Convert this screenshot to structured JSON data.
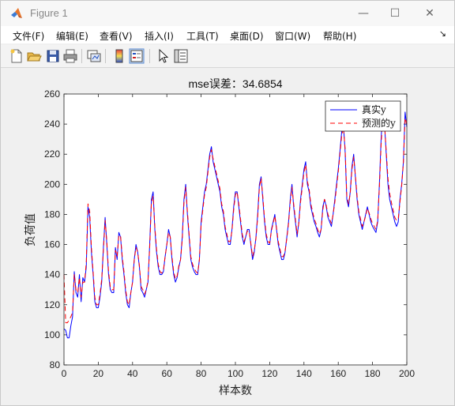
{
  "window": {
    "title": "Figure 1"
  },
  "window_controls": {
    "minimize": "—",
    "maximize": "☐",
    "close": "✕"
  },
  "menu": {
    "items": [
      "文件(F)",
      "编辑(E)",
      "查看(V)",
      "插入(I)",
      "工具(T)",
      "桌面(D)",
      "窗口(W)",
      "帮助(H)"
    ],
    "overflow": "↘"
  },
  "toolbar": {
    "icons": [
      "new-figure-icon",
      "open-file-icon",
      "save-icon",
      "print-icon",
      "link-plot-icon",
      "colorbar-icon",
      "legend-icon",
      "pointer-icon",
      "property-inspector-icon"
    ]
  },
  "chart_data": {
    "type": "line",
    "title": "mse误差：34.6854",
    "xlabel": "样本数",
    "ylabel": "负荷值",
    "xlim": [
      0,
      200
    ],
    "ylim": [
      80,
      260
    ],
    "xticks": [
      0,
      20,
      40,
      60,
      80,
      100,
      120,
      140,
      160,
      180,
      200
    ],
    "yticks": [
      80,
      100,
      120,
      140,
      160,
      180,
      200,
      220,
      240,
      260
    ],
    "legend_position": "top-right",
    "series": [
      {
        "name": "真实y",
        "color": "#0000ff",
        "style": "solid",
        "values": [
          104,
          103,
          98,
          98,
          106,
          112,
          142,
          128,
          125,
          140,
          122,
          138,
          135,
          145,
          185,
          178,
          155,
          140,
          122,
          118,
          118,
          125,
          135,
          158,
          178,
          160,
          140,
          130,
          128,
          128,
          158,
          150,
          168,
          165,
          150,
          140,
          128,
          120,
          118,
          128,
          135,
          150,
          160,
          155,
          145,
          130,
          128,
          125,
          130,
          135,
          160,
          190,
          195,
          170,
          155,
          145,
          140,
          140,
          142,
          152,
          160,
          170,
          165,
          150,
          140,
          135,
          138,
          145,
          150,
          165,
          190,
          200,
          180,
          165,
          150,
          145,
          142,
          140,
          140,
          150,
          175,
          185,
          195,
          200,
          210,
          220,
          225,
          215,
          210,
          205,
          200,
          195,
          185,
          180,
          170,
          165,
          160,
          160,
          170,
          185,
          195,
          195,
          185,
          175,
          165,
          160,
          165,
          170,
          170,
          160,
          150,
          155,
          165,
          180,
          200,
          205,
          190,
          175,
          165,
          160,
          160,
          170,
          175,
          180,
          170,
          160,
          155,
          150,
          150,
          155,
          165,
          175,
          190,
          200,
          185,
          175,
          165,
          175,
          190,
          200,
          210,
          215,
          200,
          195,
          185,
          180,
          175,
          172,
          168,
          165,
          170,
          185,
          190,
          185,
          178,
          175,
          172,
          180,
          190,
          200,
          210,
          222,
          235,
          240,
          222,
          190,
          185,
          195,
          212,
          220,
          205,
          190,
          180,
          175,
          170,
          175,
          180,
          185,
          180,
          175,
          172,
          170,
          168,
          175,
          200,
          230,
          250,
          240,
          220,
          200,
          190,
          185,
          180,
          175,
          172,
          175,
          190,
          200,
          215,
          248,
          238
        ]
      },
      {
        "name": "预测的y",
        "color": "#ff0000",
        "style": "dashed",
        "values": [
          140,
          108,
          108,
          110,
          112,
          115,
          140,
          130,
          128,
          138,
          125,
          135,
          135,
          148,
          187,
          182,
          158,
          142,
          125,
          120,
          120,
          127,
          137,
          156,
          176,
          162,
          142,
          132,
          130,
          130,
          156,
          152,
          166,
          166,
          152,
          142,
          130,
          122,
          120,
          128,
          135,
          150,
          158,
          155,
          146,
          132,
          130,
          127,
          130,
          136,
          158,
          188,
          192,
          172,
          157,
          147,
          142,
          141,
          143,
          152,
          160,
          168,
          165,
          152,
          142,
          137,
          139,
          146,
          150,
          163,
          188,
          198,
          182,
          167,
          152,
          147,
          144,
          142,
          141,
          150,
          173,
          183,
          193,
          198,
          208,
          218,
          223,
          217,
          212,
          207,
          202,
          197,
          187,
          182,
          172,
          167,
          162,
          162,
          169,
          183,
          193,
          195,
          187,
          177,
          167,
          162,
          165,
          169,
          169,
          161,
          152,
          156,
          164,
          178,
          198,
          204,
          192,
          177,
          167,
          162,
          161,
          169,
          174,
          179,
          171,
          162,
          157,
          152,
          152,
          156,
          164,
          174,
          188,
          198,
          187,
          177,
          167,
          174,
          188,
          198,
          208,
          213,
          202,
          197,
          187,
          182,
          177,
          174,
          170,
          167,
          170,
          183,
          190,
          186,
          180,
          177,
          174,
          180,
          188,
          198,
          208,
          220,
          232,
          238,
          224,
          192,
          187,
          194,
          210,
          218,
          206,
          192,
          182,
          177,
          172,
          175,
          179,
          184,
          181,
          177,
          174,
          172,
          170,
          176,
          198,
          226,
          246,
          240,
          222,
          204,
          194,
          188,
          183,
          178,
          176,
          177,
          188,
          199,
          214,
          244,
          240
        ]
      }
    ]
  }
}
